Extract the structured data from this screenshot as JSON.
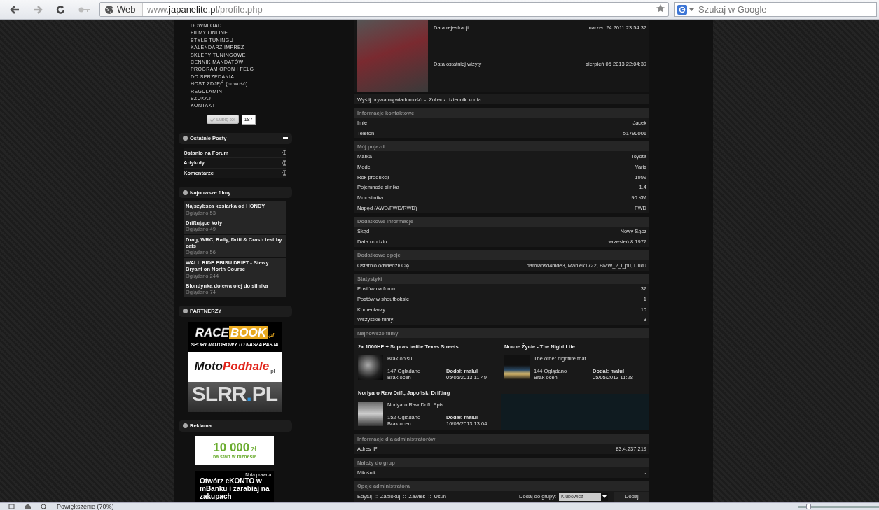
{
  "address_bar": {
    "chip": "Web",
    "url_prefix": "www.",
    "url_domain": "japanelite.pl",
    "url_path": "/profile.php"
  },
  "search": {
    "placeholder": "Szukaj w Google"
  },
  "sidebar": {
    "menu": [
      "DOWNLOAD",
      "FILMY ONLINE",
      "STYLE TUNINGU",
      "KALENDARZ IMPREZ",
      "SKLEPY TUNINGOWE",
      "CENNIK MANDATÓW",
      "PROGRAM OPON I FELG",
      "DO SPRZEDANIA",
      "HOST ZDJĘĆ (nowość)",
      "REGULAMIN",
      "SZUKAJ",
      "KONTAKT"
    ],
    "like_button": "Lubię to!",
    "like_count": "187",
    "panels": [
      {
        "kind": "links",
        "title": "Ostatnie Posty",
        "items": [
          "Ostanio na Forum",
          "Artykuły",
          "Komentarze"
        ]
      },
      {
        "kind": "films",
        "title": "Najnowsze filmy",
        "items": [
          {
            "title": "Najszybsza kosiarka od HONDY",
            "views": "Oglądano 53"
          },
          {
            "title": "Driftujące koty",
            "views": "Oglądano 49"
          },
          {
            "title": "Drag, WRC, Rally, Drift & Crash test by cats",
            "views": "Oglądano 56"
          },
          {
            "title": "WALL RIDE EBISU DRIFT - Stewy Bryant on North Course",
            "views": "Oglądano 244"
          },
          {
            "title": "Blondynka dolewa olej do silnika",
            "views": "Oglądano 74"
          }
        ]
      },
      {
        "kind": "logos",
        "title": "PARTNERZY",
        "logos": [
          {
            "kind": "racebook",
            "parts": [
              "RACE",
              "BOOK",
              ".pl",
              "SPORT MOTOROWY TO NASZA PASJA"
            ]
          },
          {
            "kind": "motopodhale",
            "parts": [
              "Moto",
              "Podhale",
              ".pl"
            ]
          },
          {
            "kind": "slrr",
            "parts": [
              "SLRR",
              ".",
              "PL"
            ]
          }
        ]
      },
      {
        "kind": "ads",
        "title": "Reklama",
        "ads": [
          {
            "kind": "green",
            "parts": [
              "10 000",
              "zł",
              "na start w biznesie"
            ]
          },
          {
            "kind": "dark",
            "parts": [
              "Nota prawna",
              "Otwórz eKONTO w mBanku i zarabiaj na zakupach"
            ]
          }
        ]
      }
    ]
  },
  "profile": {
    "rows": [
      {
        "label": "Data rejestracji",
        "value": "marzec 24 2011 23:54:32"
      },
      {
        "label": "Data ostatniej wizyty",
        "value": "sierpień 05 2013 22:04:39"
      }
    ],
    "links": [
      "Wyślij prywatną wiadomość",
      "Zobacz dziennik konta"
    ],
    "link_separator": "-"
  },
  "sections": [
    {
      "kind": "rows",
      "title": "Informacje kontaktowe",
      "rows": [
        {
          "label": "Imie",
          "value": "Jacek"
        },
        {
          "label": "Telefon",
          "value": "51790001"
        }
      ]
    },
    {
      "kind": "rows",
      "title": "Mój pojazd",
      "rows": [
        {
          "label": "Marka",
          "value": "Toyota"
        },
        {
          "label": "Model",
          "value": "Yaris"
        },
        {
          "label": "Rok produkcji",
          "value": "1999"
        },
        {
          "label": "Pojemność silnika",
          "value": "1.4"
        },
        {
          "label": "Moc silnika",
          "value": "90 KM"
        },
        {
          "label": "Napęd (AWD/FWD/RWD)",
          "value": "FWD"
        }
      ]
    },
    {
      "kind": "rows",
      "title": "Dodatkowe informacje",
      "rows": [
        {
          "label": "Skąd",
          "value": "Nowy Sącz"
        },
        {
          "label": "Data urodzin",
          "value": "wrzesień 8 1977"
        }
      ]
    },
    {
      "kind": "rows",
      "title": "Dodatkowe opcje",
      "rows": [
        {
          "label": "Ostatnio odwiedził Cię",
          "value": "damiansd4hide3, Maniek1722, BMW_2_l_pu, Dudu"
        }
      ]
    },
    {
      "kind": "rows",
      "title": "Statystyki",
      "rows": [
        {
          "label": "Postów na forum",
          "value": "37"
        },
        {
          "label": "Postów w shoutboksie",
          "value": "1"
        },
        {
          "label": "Komentarzy",
          "value": "10"
        },
        {
          "label": "Wszystkie filmy:",
          "value": "3"
        }
      ]
    },
    {
      "kind": "films",
      "title": "Najnowsze filmy",
      "films": [
        {
          "title": "2x 1000HP + Supras battle Texas Streets",
          "description": "Brak opisu.",
          "views": "147 Oglądano",
          "rating": "Brak ocen",
          "author": "Dodał: malul",
          "date": "05/05/2013 11:49"
        },
        {
          "title": "Nocne Życie - The Night Life",
          "description": "The other nightlife that...",
          "views": "144 Oglądano",
          "rating": "Brak ocen",
          "author": "Dodał: malul",
          "date": "05/05/2013 11:28"
        },
        {
          "title": "Noriyaro Raw Drift, Japoński Drifting",
          "description": "Noriyaro Raw Drift, Epis...",
          "views": "152 Oglądano",
          "rating": "Brak ocen",
          "author": "Dodał: malul",
          "date": "16/03/2013 13:04"
        }
      ]
    },
    {
      "kind": "rows",
      "title": "Informacje dla administratorów",
      "rows": [
        {
          "label": "Adres IP",
          "value": "83.4.237.219"
        }
      ]
    },
    {
      "kind": "rows",
      "title": "Należy do grup",
      "rows": [
        {
          "label": "Miłośnik",
          "value": "-"
        }
      ]
    },
    {
      "kind": "admin",
      "title": "Opcje administratora",
      "actions": [
        "Edytuj",
        "Zablokuj",
        "Zawieś",
        "Usuń"
      ],
      "separator": "::",
      "group_label": "Dodaj do grupy:",
      "group_value": "Klubowicz",
      "button": "Dodaj"
    }
  ],
  "status_bar": {
    "text": "Powiększenie (70%)",
    "zoom_slider": {
      "level": 0.13
    }
  }
}
